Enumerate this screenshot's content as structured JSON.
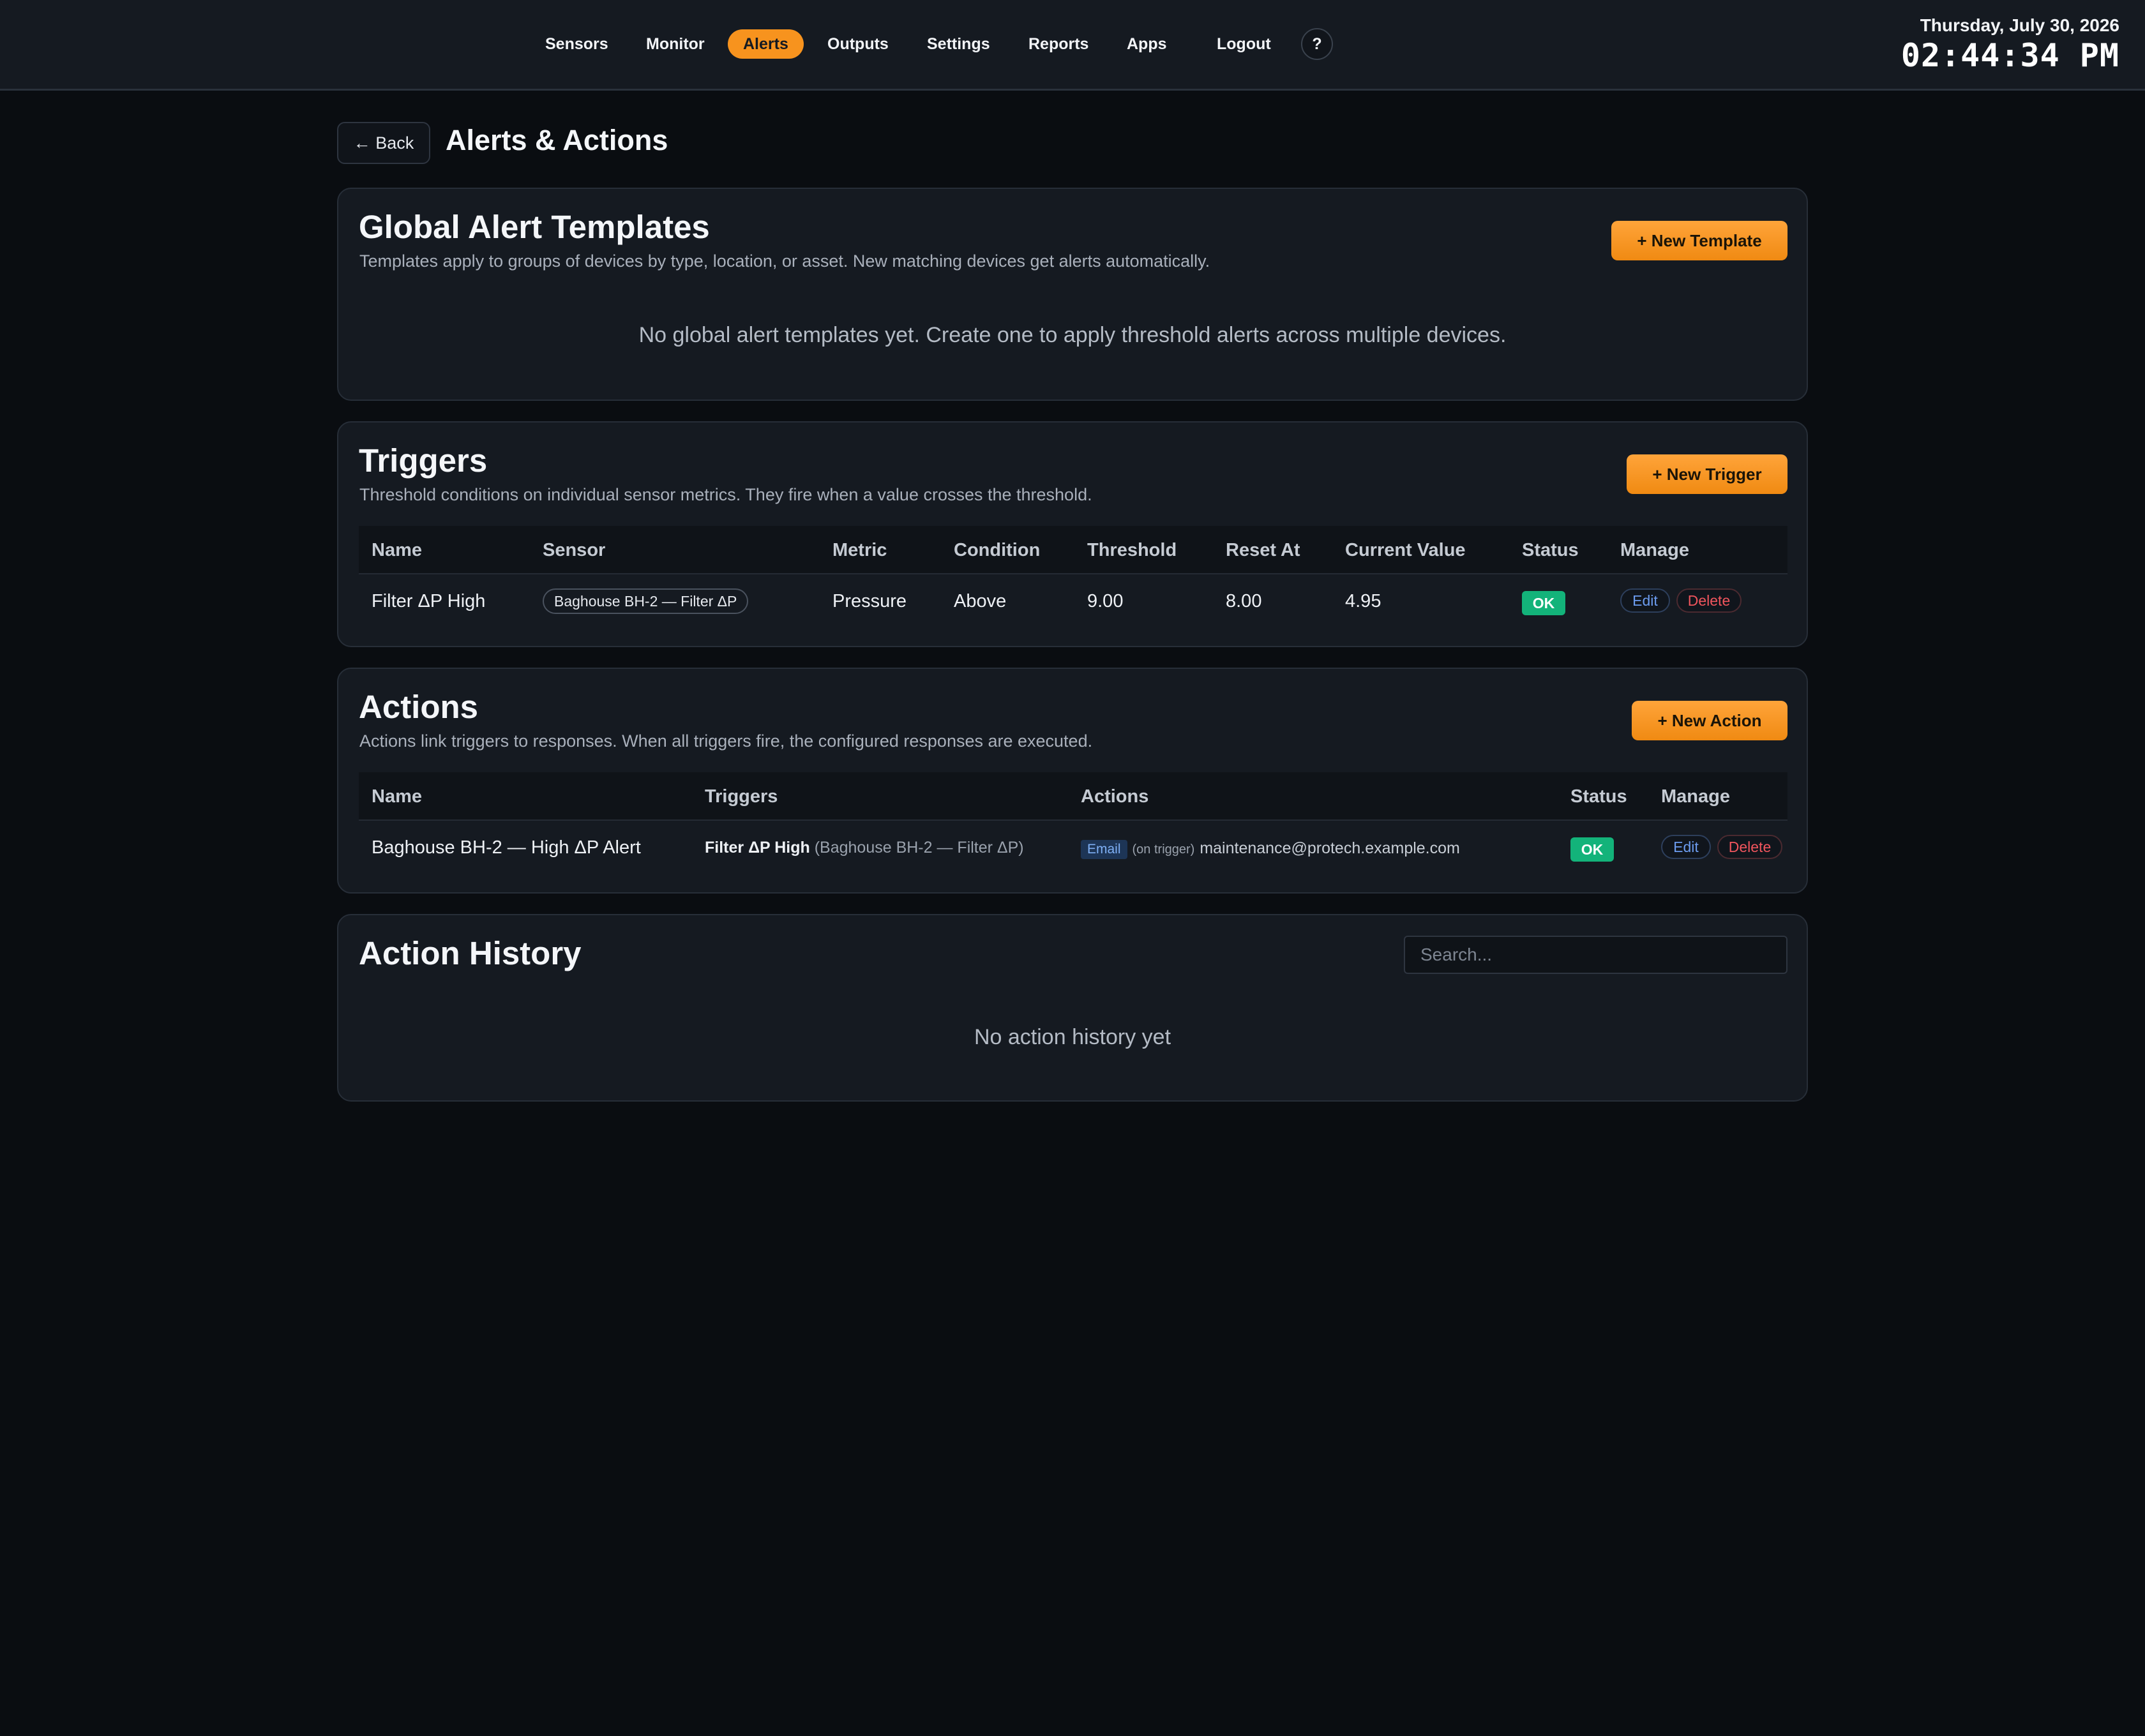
{
  "nav": {
    "items": [
      {
        "label": "Sensors",
        "active": false
      },
      {
        "label": "Monitor",
        "active": false
      },
      {
        "label": "Alerts",
        "active": true
      },
      {
        "label": "Outputs",
        "active": false
      },
      {
        "label": "Settings",
        "active": false
      },
      {
        "label": "Reports",
        "active": false
      },
      {
        "label": "Apps",
        "active": false
      },
      {
        "label": "Logout",
        "active": false
      }
    ],
    "help_label": "?"
  },
  "clock": {
    "date": "Thursday, July 30, 2026",
    "time": "02:44:34 PM"
  },
  "page": {
    "back_label": "← Back",
    "title": "Alerts & Actions"
  },
  "templates": {
    "title": "Global Alert Templates",
    "description": "Templates apply to groups of devices by type, location, or asset. New matching devices get alerts automatically.",
    "new_button": "+ New Template",
    "empty": "No global alert templates yet. Create one to apply threshold alerts across multiple devices."
  },
  "triggers": {
    "title": "Triggers",
    "description": "Threshold conditions on individual sensor metrics. They fire when a value crosses the threshold.",
    "new_button": "+ New Trigger",
    "columns": [
      "Name",
      "Sensor",
      "Metric",
      "Condition",
      "Threshold",
      "Reset At",
      "Current Value",
      "Status",
      "Manage"
    ],
    "rows": [
      {
        "name": "Filter ΔP High",
        "sensor": "Baghouse BH-2 — Filter ΔP",
        "metric": "Pressure",
        "condition": "Above",
        "threshold": "9.00",
        "reset_at": "8.00",
        "current_value": "4.95",
        "status": "OK",
        "edit": "Edit",
        "delete": "Delete"
      }
    ]
  },
  "actions": {
    "title": "Actions",
    "description": "Actions link triggers to responses. When all triggers fire, the configured responses are executed.",
    "new_button": "+ New Action",
    "columns": [
      "Name",
      "Triggers",
      "Actions",
      "Status",
      "Manage"
    ],
    "rows": [
      {
        "name": "Baghouse BH-2 — High ΔP Alert",
        "trigger_name": "Filter ΔP High",
        "trigger_detail": "(Baghouse BH-2 — Filter ΔP)",
        "action_type": "Email",
        "action_when": "(on trigger)",
        "action_target": "maintenance@protech.example.com",
        "status": "OK",
        "edit": "Edit",
        "delete": "Delete"
      }
    ]
  },
  "history": {
    "title": "Action History",
    "search_placeholder": "Search...",
    "empty": "No action history yet"
  },
  "colors": {
    "accent": "#f7931e",
    "ok": "#13b37a",
    "background": "#0a0d11",
    "card": "#151a21"
  }
}
